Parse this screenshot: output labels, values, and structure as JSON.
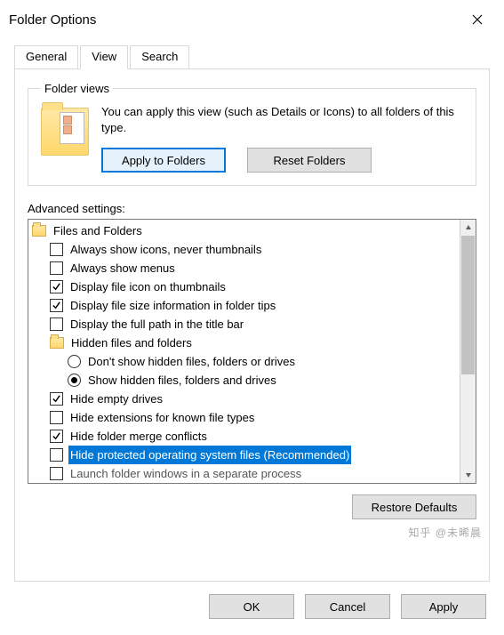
{
  "window": {
    "title": "Folder Options"
  },
  "tabs": {
    "general": "General",
    "view": "View",
    "search": "Search",
    "active": "view"
  },
  "folder_views": {
    "legend": "Folder views",
    "description": "You can apply this view (such as Details or Icons) to all folders of this type.",
    "apply_btn": "Apply to Folders",
    "reset_btn": "Reset Folders"
  },
  "advanced": {
    "label": "Advanced settings:",
    "items": [
      {
        "kind": "folder",
        "level": 1,
        "label": "Files and Folders"
      },
      {
        "kind": "check",
        "level": 2,
        "checked": false,
        "label": "Always show icons, never thumbnails"
      },
      {
        "kind": "check",
        "level": 2,
        "checked": false,
        "label": "Always show menus"
      },
      {
        "kind": "check",
        "level": 2,
        "checked": true,
        "label": "Display file icon on thumbnails"
      },
      {
        "kind": "check",
        "level": 2,
        "checked": true,
        "label": "Display file size information in folder tips"
      },
      {
        "kind": "check",
        "level": 2,
        "checked": false,
        "label": "Display the full path in the title bar"
      },
      {
        "kind": "folder",
        "level": 2,
        "label": "Hidden files and folders"
      },
      {
        "kind": "radio",
        "level": 3,
        "checked": false,
        "label": "Don't show hidden files, folders or drives"
      },
      {
        "kind": "radio",
        "level": 3,
        "checked": true,
        "label": "Show hidden files, folders and drives"
      },
      {
        "kind": "check",
        "level": 2,
        "checked": true,
        "label": "Hide empty drives"
      },
      {
        "kind": "check",
        "level": 2,
        "checked": false,
        "label": "Hide extensions for known file types"
      },
      {
        "kind": "check",
        "level": 2,
        "checked": true,
        "label": "Hide folder merge conflicts"
      },
      {
        "kind": "check",
        "level": 2,
        "checked": false,
        "selected": true,
        "label": "Hide protected operating system files (Recommended)"
      },
      {
        "kind": "check",
        "level": 2,
        "checked": false,
        "truncated": true,
        "label": "Launch folder windows in a separate process"
      }
    ],
    "restore_btn": "Restore Defaults"
  },
  "footer": {
    "ok": "OK",
    "cancel": "Cancel",
    "apply": "Apply"
  },
  "watermark": "知乎 @未晞晨"
}
